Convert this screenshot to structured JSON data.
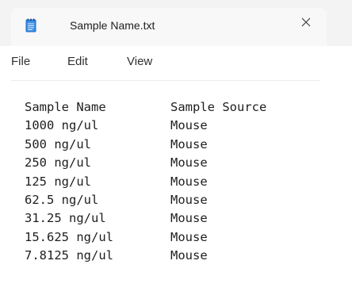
{
  "window": {
    "tab_title": "Sample Name.txt",
    "tab_icon": "notepad-icon",
    "close_icon": "close-icon"
  },
  "menu": {
    "items": [
      {
        "label": "File"
      },
      {
        "label": "Edit"
      },
      {
        "label": "View"
      }
    ]
  },
  "document": {
    "lines": [
      {
        "name": "Sample Name",
        "source": "Sample Source"
      },
      {
        "name": "1000 ng/ul",
        "source": "Mouse"
      },
      {
        "name": "500 ng/ul",
        "source": "Mouse"
      },
      {
        "name": "250 ng/ul",
        "source": "Mouse"
      },
      {
        "name": "125 ng/ul",
        "source": "Mouse"
      },
      {
        "name": "62.5 ng/ul",
        "source": "Mouse"
      },
      {
        "name": "31.25 ng/ul",
        "source": "Mouse"
      },
      {
        "name": "15.625 ng/ul",
        "source": "Mouse"
      },
      {
        "name": "7.8125 ng/ul",
        "source": "Mouse"
      }
    ]
  },
  "colors": {
    "titlebar_bg": "#f3f3f3",
    "icon_blue": "#1e6fc8",
    "text": "#1e1e1e"
  }
}
